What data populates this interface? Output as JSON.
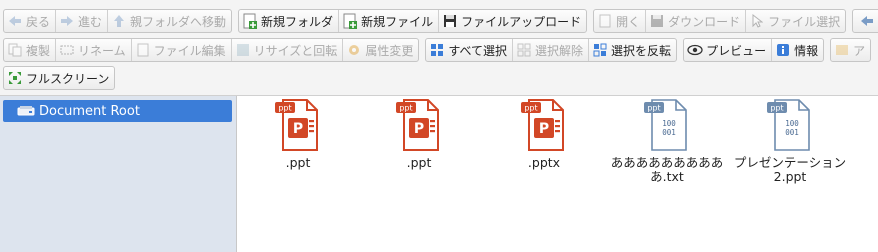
{
  "toolbar": {
    "back": "戻る",
    "forward": "進む",
    "parent": "親フォルダへ移動",
    "new_folder": "新規フォルダ",
    "new_file": "新規ファイル",
    "upload": "ファイルアップロード",
    "open": "開く",
    "download": "ダウンロード",
    "select_file": "ファイル選択",
    "copy": "複製",
    "rename": "リネーム",
    "edit": "ファイル編集",
    "resize": "リサイズと回転",
    "chmod": "属性変更",
    "select_all": "すべて選択",
    "select_none": "選択解除",
    "invert": "選択を反転",
    "preview": "プレビュー",
    "info": "情報",
    "archive_partial": "ア",
    "fullscreen": "フルスクリーン"
  },
  "tree": {
    "root": "Document Root"
  },
  "files": [
    {
      "name": ".ppt",
      "badge": "ppt",
      "kind": "powerpoint"
    },
    {
      "name": ".ppt",
      "badge": "ppt",
      "kind": "powerpoint"
    },
    {
      "name": ".pptx",
      "badge": "ppt",
      "kind": "powerpoint"
    },
    {
      "name": "ああああああああああ.txt",
      "badge": "ppt",
      "kind": "binary"
    },
    {
      "name": "プレゼンテーション2.ppt",
      "badge": "ppt",
      "kind": "binary"
    }
  ],
  "colors": {
    "accent": "#3b7dd8",
    "powerpoint": "#d24726",
    "binary": "#6e8cae"
  }
}
